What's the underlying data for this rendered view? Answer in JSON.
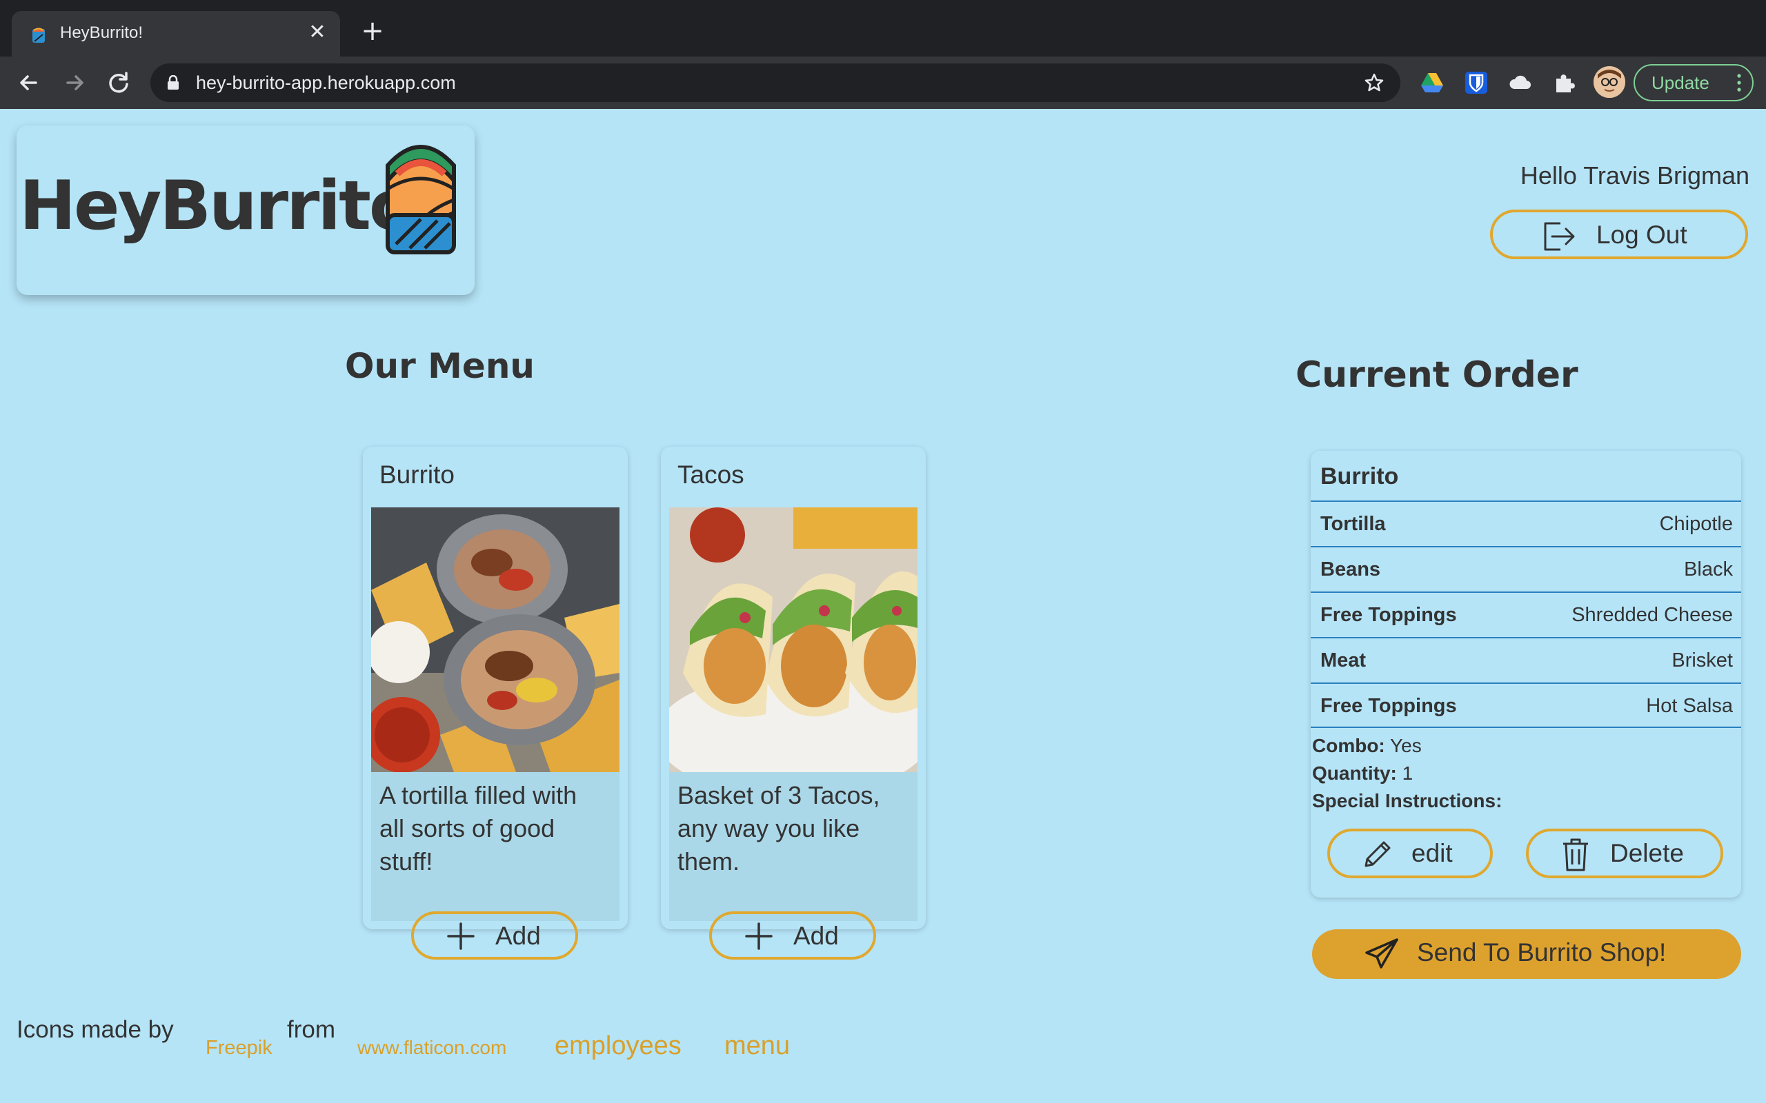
{
  "browser": {
    "tab_title": "HeyBurrito!",
    "tab_close": "✕",
    "new_tab": "+",
    "url": "hey-burrito-app.herokuapp.com",
    "update_label": "Update"
  },
  "header": {
    "logo_text": "HeyBurrito!",
    "greeting": "Hello Travis Brigman",
    "logout_label": "Log Out"
  },
  "menu": {
    "heading": "Our Menu",
    "items": [
      {
        "title": "Burrito",
        "description": "A tortilla filled with all sorts of good stuff!",
        "add_label": "Add"
      },
      {
        "title": "Tacos",
        "description": "Basket of 3 Tacos, any way you like them.",
        "add_label": "Add"
      }
    ]
  },
  "order": {
    "heading": "Current Order",
    "item_title": "Burrito",
    "rows": [
      {
        "label": "Tortilla",
        "value": "Chipotle"
      },
      {
        "label": "Beans",
        "value": "Black"
      },
      {
        "label": "Free Toppings",
        "value": "Shredded Cheese"
      },
      {
        "label": "Meat",
        "value": "Brisket"
      },
      {
        "label": "Free Toppings",
        "value": "Hot Salsa"
      }
    ],
    "combo_label": "Combo:",
    "combo_value": "Yes",
    "quantity_label": "Quantity:",
    "quantity_value": "1",
    "special_label": "Special Instructions:",
    "special_value": "",
    "edit_label": "edit",
    "delete_label": "Delete",
    "send_label": "Send To Burrito Shop!"
  },
  "footer": {
    "icons_made_by": "Icons made by",
    "freepik": "Freepik",
    "from": "from",
    "flaticon": "www.flaticon.com",
    "employees": "employees",
    "menu": "menu"
  },
  "colors": {
    "page_bg": "#b5e4f7",
    "accent": "#e0a82e",
    "row_border": "#2a7fbf",
    "text": "#333333"
  }
}
